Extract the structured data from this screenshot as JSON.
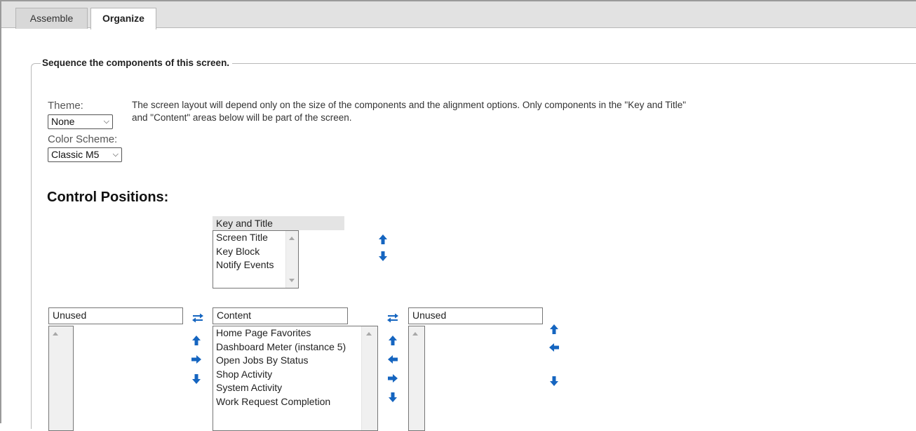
{
  "tabs": [
    {
      "label": "Assemble",
      "active": false
    },
    {
      "label": "Organize",
      "active": true
    }
  ],
  "section_legend": "Sequence the components of this screen.",
  "theme": {
    "label": "Theme:",
    "value": "None"
  },
  "color_scheme": {
    "label": "Color Scheme:",
    "value": "Classic M5"
  },
  "description": {
    "line1": "The screen layout will depend only on the size of the components and the alignment options. Only components in the \"Key and Title\"",
    "line2": "and \"Content\" areas below will be part of the screen."
  },
  "control_positions_heading": "Control Positions:",
  "key_and_title": {
    "header": "Key and Title",
    "items": [
      "Screen Title",
      "Key Block",
      "Notify Events"
    ]
  },
  "left_unused": {
    "header": "Unused",
    "items": []
  },
  "content": {
    "header": "Content",
    "items": [
      "Home Page Favorites",
      "Dashboard Meter (instance 5)",
      "Open Jobs By Status",
      "Shop Activity",
      "System Activity",
      "Work Request Completion"
    ]
  },
  "right_unused": {
    "header": "Unused",
    "items": []
  },
  "colors": {
    "icon_blue": "#1565c0",
    "tab_bar": "#e2e2e2",
    "border": "#767676"
  }
}
